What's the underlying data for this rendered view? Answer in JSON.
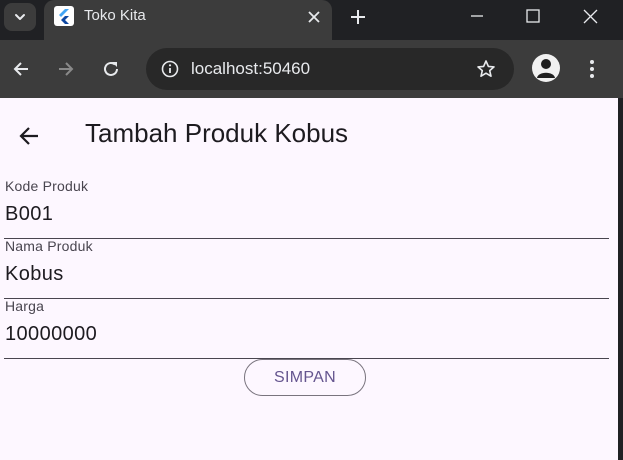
{
  "browser": {
    "tab": {
      "title": "Toko Kita",
      "favicon": "flutter-icon"
    },
    "url": "localhost:50460",
    "icons": {
      "tab_list": "chevron-down-icon",
      "tab_close": "close-icon",
      "new_tab": "plus-icon",
      "minimize": "minimize-icon",
      "maximize": "maximize-icon",
      "close_window": "close-icon",
      "back": "arrow-left-icon",
      "forward": "arrow-right-icon",
      "reload": "reload-icon",
      "site_info": "info-icon",
      "bookmark": "star-icon",
      "profile": "profile-icon",
      "menu": "more-vertical-icon"
    }
  },
  "app": {
    "appbar": {
      "title": "Tambah Produk Kobus",
      "back_icon": "arrow-left-icon"
    },
    "fields": [
      {
        "label": "Kode Produk",
        "value": "B001"
      },
      {
        "label": "Nama Produk",
        "value": "Kobus"
      },
      {
        "label": "Harga",
        "value": "10000000"
      }
    ],
    "save_button": "SIMPAN",
    "colors": {
      "background": "#fdf7ff",
      "primary": "#65558f",
      "outline": "#79747e"
    }
  }
}
